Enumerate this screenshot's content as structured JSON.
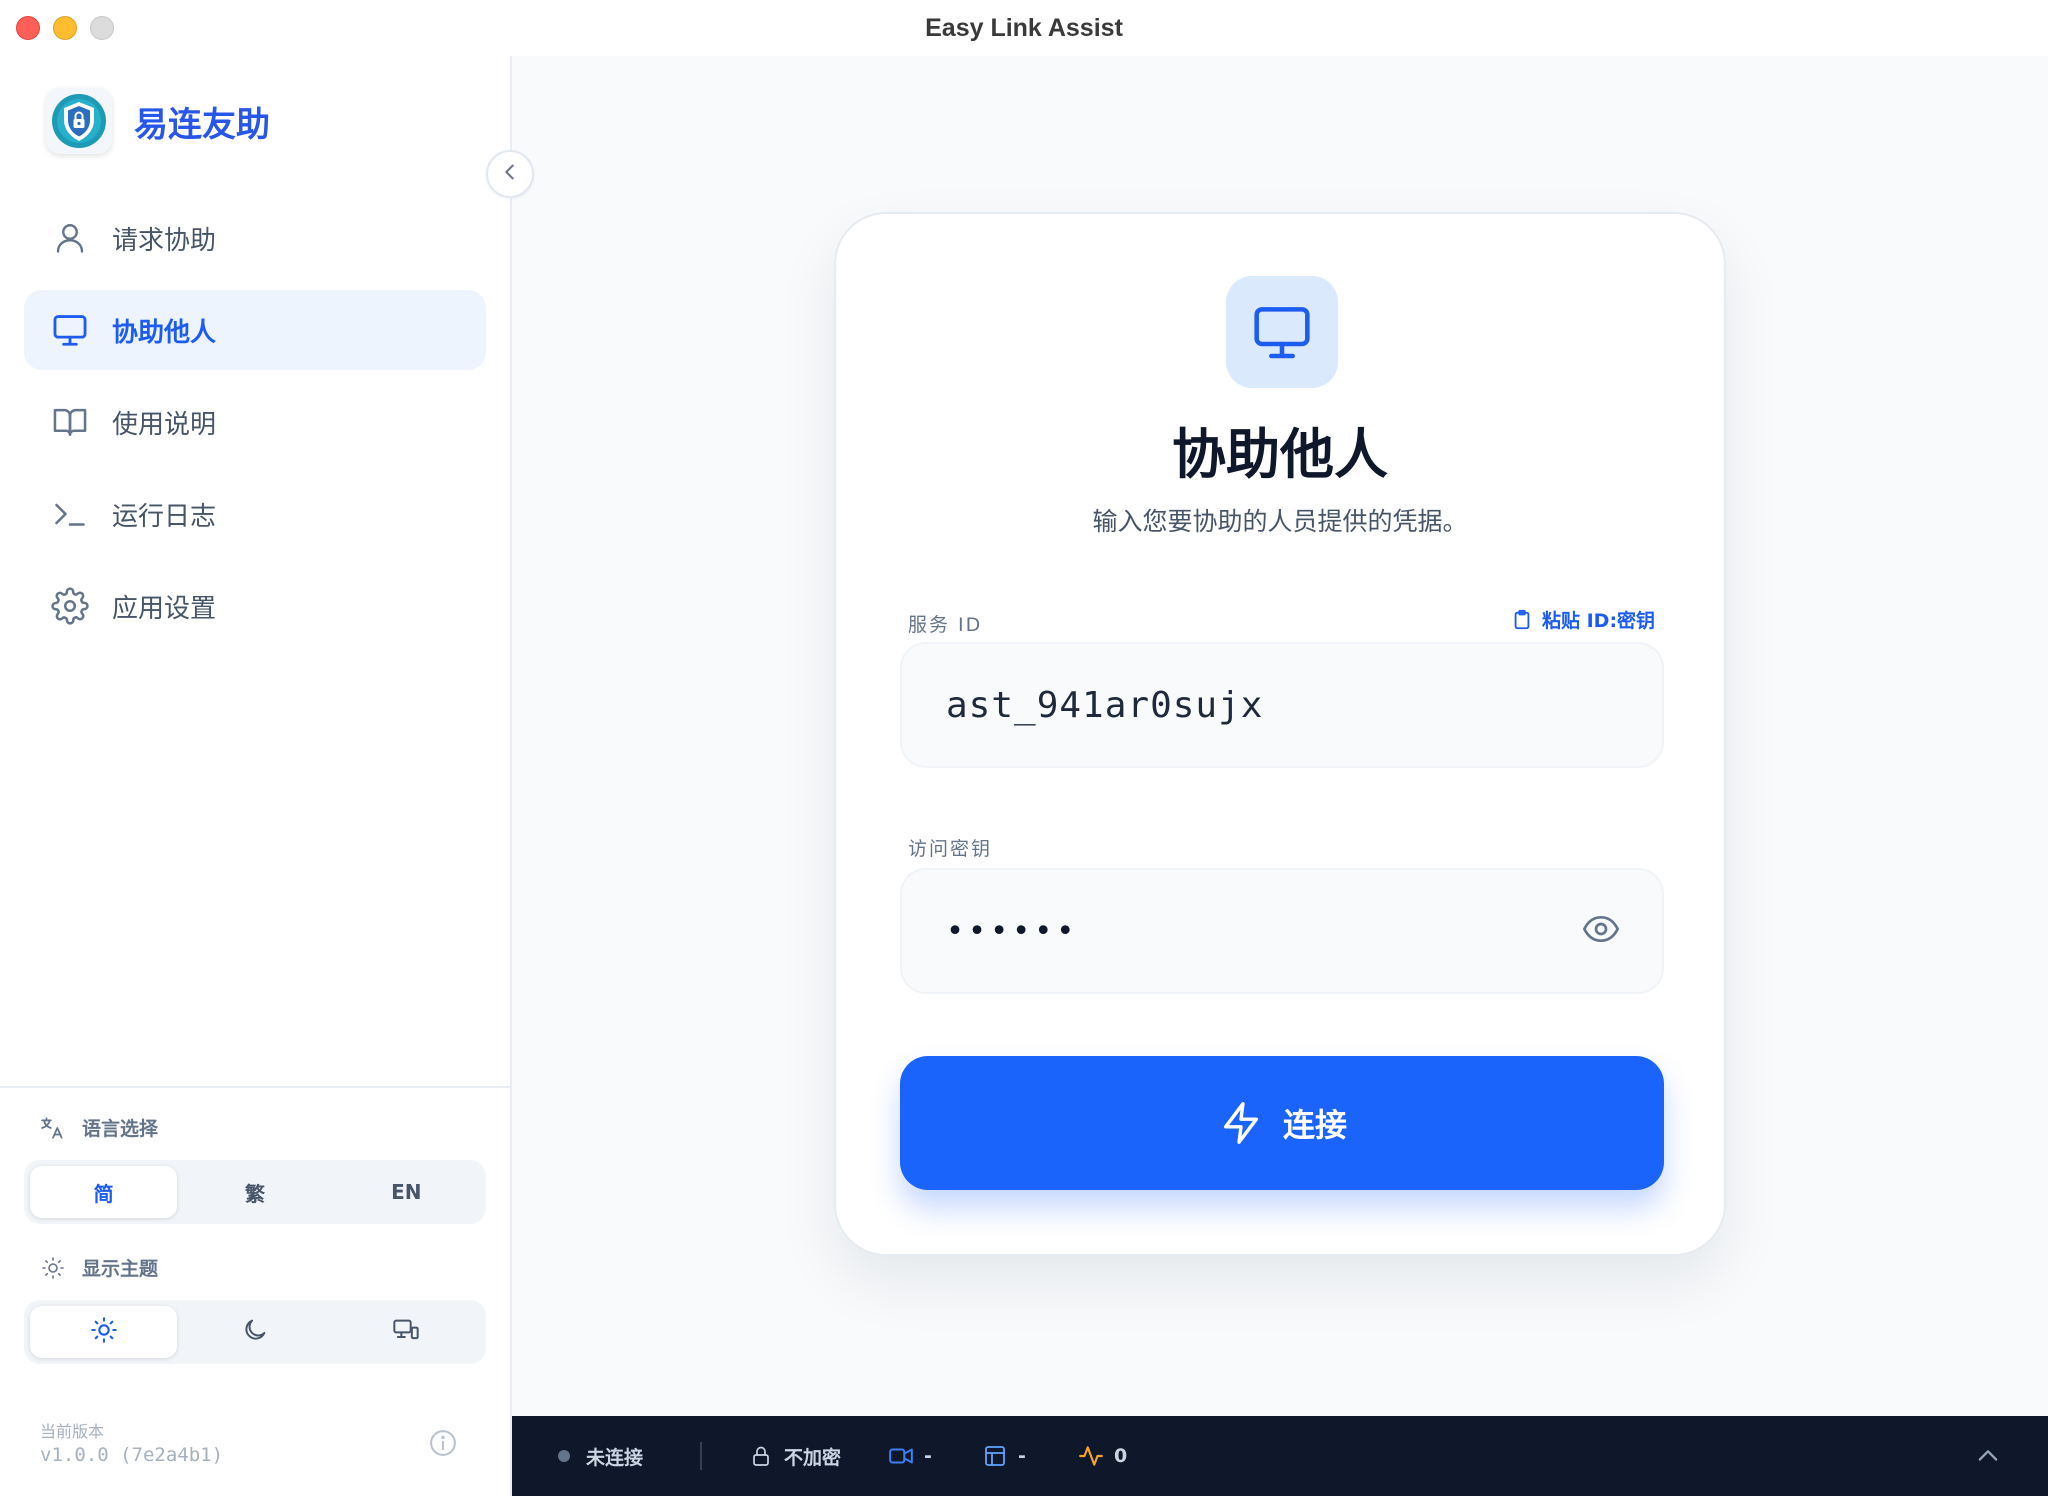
{
  "window": {
    "title": "Easy Link Assist"
  },
  "brand": {
    "name": "易连友助",
    "logo_icon": "shield-lock-icon"
  },
  "sidebar": {
    "collapse_icon": "chevron-left-icon",
    "items": [
      {
        "label": "请求协助",
        "icon": "user-icon",
        "active": false
      },
      {
        "label": "协助他人",
        "icon": "monitor-icon",
        "active": true
      },
      {
        "label": "使用说明",
        "icon": "book-icon",
        "active": false
      },
      {
        "label": "运行日志",
        "icon": "terminal-icon",
        "active": false
      },
      {
        "label": "应用设置",
        "icon": "gear-icon",
        "active": false
      }
    ],
    "language": {
      "label": "语言选择",
      "options": [
        "简",
        "繁",
        "EN"
      ],
      "selected": "简"
    },
    "theme": {
      "label": "显示主题",
      "options": [
        "sun-icon",
        "moon-icon",
        "monitor-system-icon"
      ],
      "selected": "sun-icon"
    },
    "version": {
      "label": "当前版本",
      "value": "v1.0.0 (7e2a4b1)"
    }
  },
  "card": {
    "title": "协助他人",
    "subtitle": "输入您要协助的人员提供的凭据。",
    "service_id": {
      "label": "服务 ID",
      "value": "ast_941ar0sujx"
    },
    "paste_label": "粘贴 ID:密钥",
    "access_key": {
      "label": "访问密钥",
      "masked": "••••••"
    },
    "connect_label": "连接"
  },
  "statusbar": {
    "connection": "未连接",
    "encryption": "不加密",
    "video": "-",
    "layout": "-",
    "activity": "0"
  },
  "colors": {
    "accent": "#1a64fb",
    "brand_text": "#2856e8",
    "active_nav_bg": "#eef4fd",
    "statusbar_bg": "#0f172a",
    "activity": "#f5a524"
  }
}
